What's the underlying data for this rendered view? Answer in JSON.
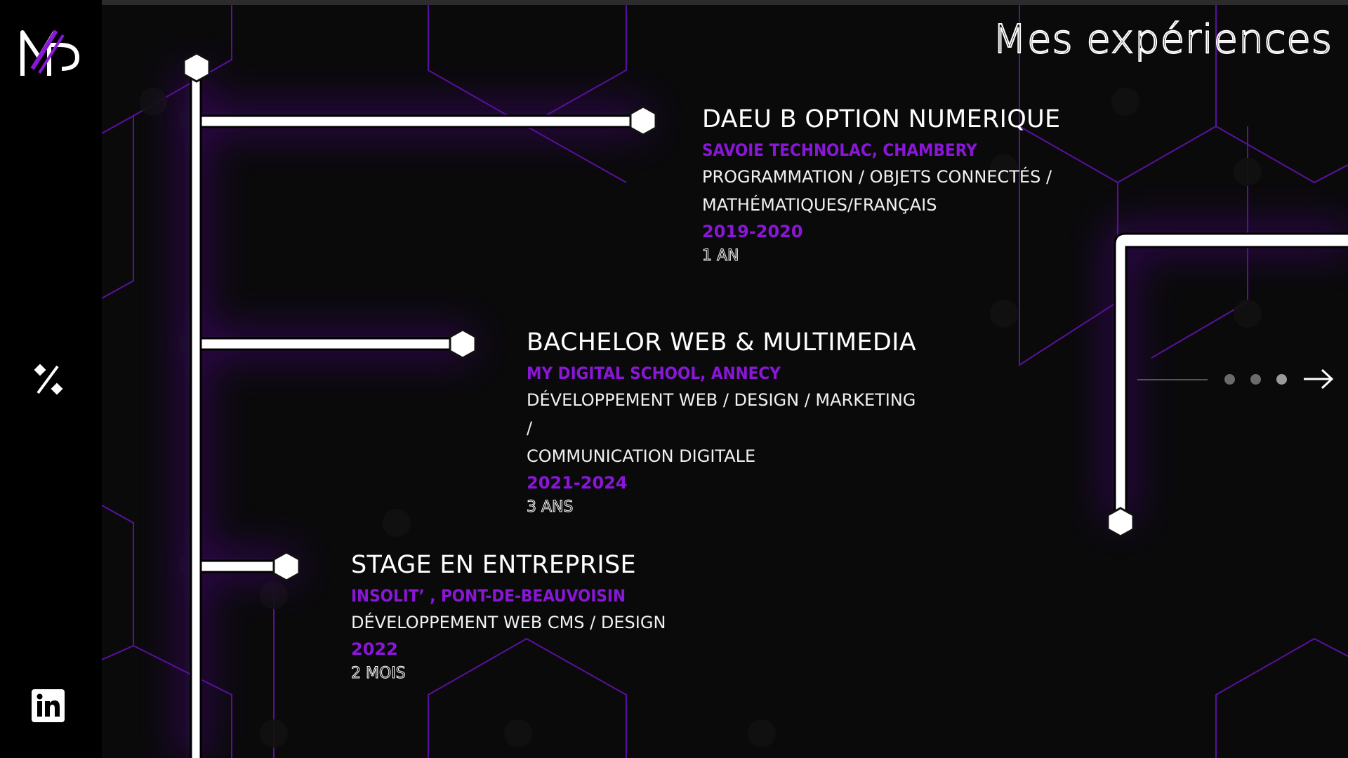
{
  "page": {
    "title": "Mes expériences"
  },
  "sidebar": {
    "logo": "MP-logo",
    "icons": [
      "percent-icon",
      "linkedin-icon"
    ]
  },
  "experiences": [
    {
      "title": "DAEU B OPTION NUMERIQUE",
      "school": "SAVOIE TECHNOLAC, CHAMBERY",
      "desc_line1": "PROGRAMMATION / OBJETS CONNECTÉS /",
      "desc_line2": "MATHÉMATIQUES/FRANÇAIS",
      "years": "2019-2020",
      "duration": "1 AN"
    },
    {
      "title": "BACHELOR WEB & MULTIMEDIA",
      "school": "MY DIGITAL SCHOOL, ANNECY",
      "desc_line1": "DÉVELOPPEMENT WEB / DESIGN / MARKETING /",
      "desc_line2": "COMMUNICATION DIGITALE",
      "years": "2021-2024",
      "duration": "3 ANS"
    },
    {
      "title": "STAGE EN ENTREPRISE",
      "school": "INSOLIT’ , PONT-DE-BEAUVOISIN",
      "desc_line1": "DÉVELOPPEMENT WEB CMS / DESIGN",
      "desc_line2": "",
      "years": "2022",
      "duration": "2 MOIS"
    }
  ],
  "colors": {
    "accent": "#8a16d8",
    "background": "#0a0a0b"
  },
  "slider": {
    "pages": 3,
    "next_icon": "arrow-right-icon"
  }
}
